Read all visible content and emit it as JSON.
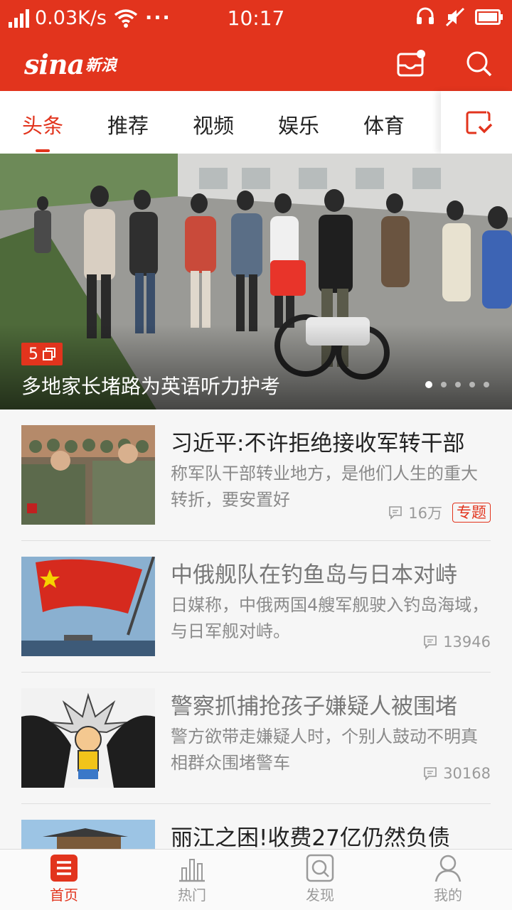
{
  "status_bar": {
    "speed": "0.03K/s",
    "dots": "···",
    "time": "10:17"
  },
  "header": {
    "logo_text": "sina",
    "logo_cn": "新浪"
  },
  "tabs": [
    {
      "label": "头条",
      "active": true
    },
    {
      "label": "推荐"
    },
    {
      "label": "视频"
    },
    {
      "label": "娱乐"
    },
    {
      "label": "体育"
    }
  ],
  "hero": {
    "image_count": "5",
    "title": "多地家长堵路为英语听力护考",
    "slide_count": 5,
    "current_slide": 1
  },
  "news": [
    {
      "title": "习近平:不许拒绝接收军转干部",
      "summary": "称军队干部转业地方，是他们人生的重大转折，要安置好",
      "comments": "16万",
      "tag": "专题"
    },
    {
      "title": "中俄舰队在钓鱼岛与日本对峙",
      "summary": "日媒称，中俄两国4艘军舰驶入钓岛海域，与日军舰对峙。",
      "comments": "13946"
    },
    {
      "title": "警察抓捕抢孩子嫌疑人被围堵",
      "summary": "警方欲带走嫌疑人时，个别人鼓动不明真相群众围堵警车",
      "comments": "30168"
    },
    {
      "title": "丽江之困!收费27亿仍然负债",
      "summary": ""
    }
  ],
  "bottom_nav": [
    {
      "label": "首页",
      "icon": "home-icon",
      "active": true
    },
    {
      "label": "热门",
      "icon": "chart-icon"
    },
    {
      "label": "发现",
      "icon": "discover-icon"
    },
    {
      "label": "我的",
      "icon": "user-icon"
    }
  ],
  "colors": {
    "brand_red": "#e2341d",
    "text_dark": "#222222",
    "text_gray": "#8a8a8a"
  }
}
